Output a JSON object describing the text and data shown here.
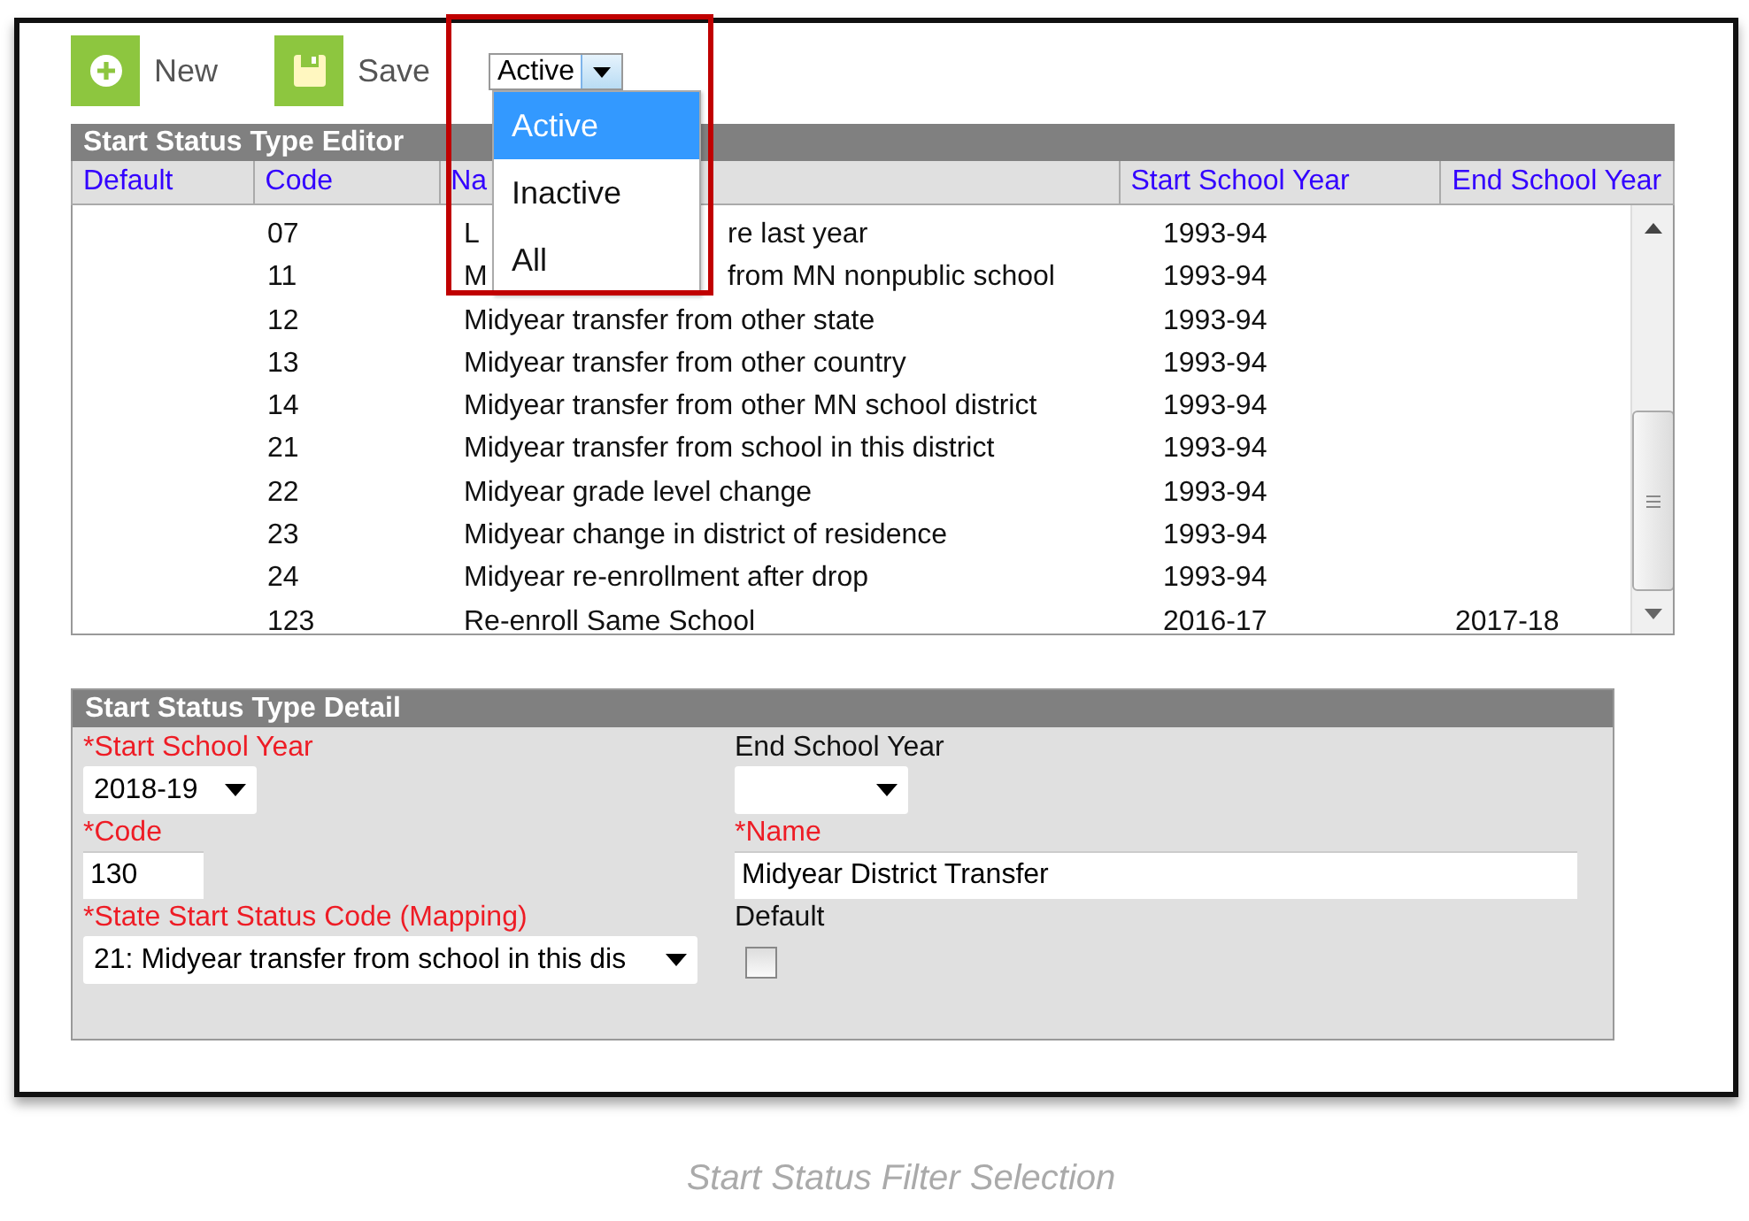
{
  "toolbar": {
    "buttons": [
      {
        "kind": "new",
        "label": "New"
      },
      {
        "kind": "save",
        "label": "Save"
      }
    ],
    "filter": {
      "value": "Active",
      "expanded": true,
      "options": [
        {
          "label": "Active",
          "selected": true
        },
        {
          "label": "Inactive",
          "selected": false
        },
        {
          "label": "All",
          "selected": false
        }
      ]
    }
  },
  "editor": {
    "title": "Start Status Type Editor",
    "columns": [
      "Default",
      "Code",
      "Na",
      "Start School Year",
      "End School Year"
    ],
    "rows": [
      {
        "code": "07",
        "name": [
          "L",
          "re last year"
        ],
        "start": "1993-94"
      },
      {
        "code": "11",
        "name": [
          "M",
          "from MN nonpublic school"
        ],
        "start": "1993-94"
      },
      {
        "code": "12",
        "name": [
          "Midyear transfer from other state"
        ],
        "start": "1993-94"
      },
      {
        "code": "13",
        "name": [
          "Midyear transfer from other country"
        ],
        "start": "1993-94"
      },
      {
        "code": "14",
        "name": [
          "Midyear transfer from other MN school district"
        ],
        "start": "1993-94"
      },
      {
        "code": "21",
        "name": [
          "Midyear transfer from school in this district"
        ],
        "start": "1993-94"
      },
      {
        "code": "22",
        "name": [
          "Midyear grade level change"
        ],
        "start": "1993-94"
      },
      {
        "code": "23",
        "name": [
          "Midyear change in district of residence"
        ],
        "start": "1993-94"
      },
      {
        "code": "24",
        "name": [
          "Midyear re-enrollment after drop"
        ],
        "start": "1993-94"
      },
      {
        "code": "123",
        "name": [
          "Re-enroll Same School"
        ],
        "start": "2016-17",
        "end": "2017-18"
      }
    ]
  },
  "detail": {
    "title": "Start Status Type Detail",
    "fields": [
      {
        "kind": "select",
        "label": "*Start School Year",
        "required": true,
        "value": "2018-19"
      },
      {
        "kind": "select",
        "label": "End School Year",
        "required": false
      },
      {
        "kind": "text",
        "label": "*Code",
        "required": true,
        "value": "130"
      },
      {
        "kind": "text",
        "label": "*Name",
        "required": true,
        "value": "Midyear District Transfer"
      },
      {
        "kind": "select",
        "label": "*State Start Status Code (Mapping)",
        "required": true,
        "value": "21: Midyear transfer from school in this dis"
      },
      {
        "kind": "checkbox",
        "label": "Default",
        "required": false,
        "checked": false
      }
    ]
  },
  "caption": "Start Status Filter Selection"
}
